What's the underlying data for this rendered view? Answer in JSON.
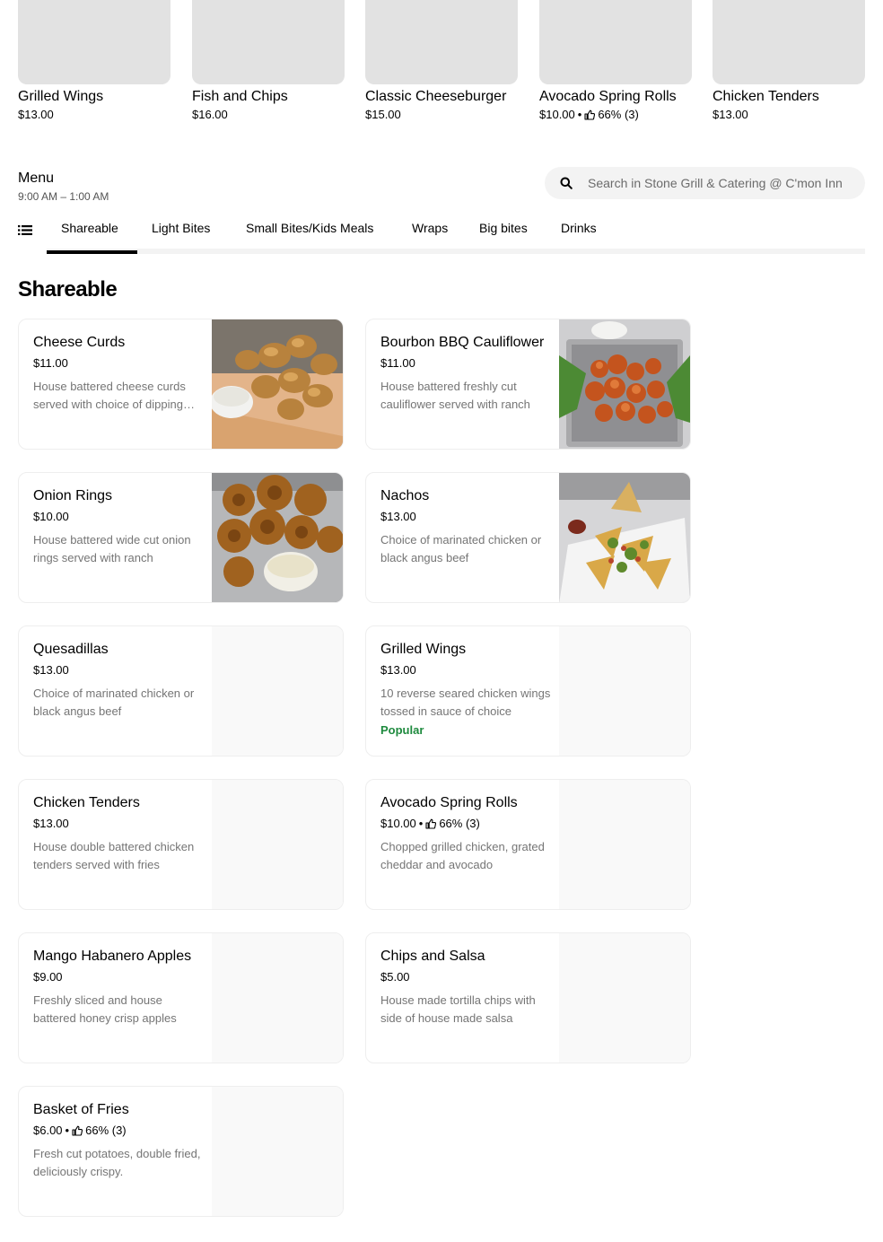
{
  "featured": [
    {
      "name": "Grilled Wings",
      "price": "$13.00",
      "rating": ""
    },
    {
      "name": "Fish and Chips",
      "price": "$16.00",
      "rating": ""
    },
    {
      "name": "Classic Cheeseburger",
      "price": "$15.00",
      "rating": ""
    },
    {
      "name": "Avocado Spring Rolls",
      "price": "$10.00",
      "rating": "66% (3)"
    },
    {
      "name": "Chicken Tenders",
      "price": "$13.00",
      "rating": ""
    }
  ],
  "menu": {
    "title": "Menu",
    "hours": "9:00 AM – 1:00 AM",
    "search_placeholder": "Search in Stone Grill & Catering @ C'mon Inn"
  },
  "tabs": [
    "Shareable",
    "Light Bites",
    "Small Bites/Kids Meals",
    "Wraps",
    "Big bites",
    "Drinks"
  ],
  "section": {
    "title": "Shareable"
  },
  "items": [
    {
      "name": "Cheese Curds",
      "price": "$11.00",
      "rating": "",
      "desc": "House battered cheese curds served with choice of dipping sauce",
      "badge": "",
      "image": "cheese-curds-photo"
    },
    {
      "name": "Bourbon BBQ Cauliflower",
      "price": "$11.00",
      "rating": "",
      "desc": "House battered freshly cut cauliflower served with ranch",
      "badge": "",
      "image": "cauliflower-photo"
    },
    {
      "name": "Onion Rings",
      "price": "$10.00",
      "rating": "",
      "desc": "House battered wide cut onion rings served with ranch",
      "badge": "",
      "image": "onion-rings-photo"
    },
    {
      "name": "Nachos",
      "price": "$13.00",
      "rating": "",
      "desc": "Choice of marinated chicken or black angus beef",
      "badge": "",
      "image": "nachos-photo"
    },
    {
      "name": "Quesadillas",
      "price": "$13.00",
      "rating": "",
      "desc": "Choice of marinated chicken or black angus beef",
      "badge": "",
      "image": ""
    },
    {
      "name": "Grilled Wings",
      "price": "$13.00",
      "rating": "",
      "desc": "10 reverse seared chicken wings tossed in sauce of choice",
      "badge": "Popular",
      "image": ""
    },
    {
      "name": "Chicken Tenders",
      "price": "$13.00",
      "rating": "",
      "desc": "House double battered chicken tenders served with fries",
      "badge": "",
      "image": ""
    },
    {
      "name": "Avocado Spring Rolls",
      "price": "$10.00",
      "rating": "66% (3)",
      "desc": "Chopped grilled chicken, grated cheddar and avocado",
      "badge": "",
      "image": ""
    },
    {
      "name": "Mango Habanero Apples",
      "price": "$9.00",
      "rating": "",
      "desc": "Freshly sliced and house battered honey crisp apples",
      "badge": "",
      "image": ""
    },
    {
      "name": "Chips and Salsa",
      "price": "$5.00",
      "rating": "",
      "desc": "House made tortilla chips with side of house made salsa",
      "badge": "",
      "image": ""
    },
    {
      "name": "Basket of Fries",
      "price": "$6.00",
      "rating": "66% (3)",
      "desc": "Fresh cut potatoes, double fried, deliciously crispy.",
      "badge": "",
      "image": ""
    }
  ],
  "colors": {
    "popular": "#1e8a3e",
    "muted_text": "#757575",
    "placeholder_bg": "#f9f9f9",
    "featured_bg": "#e2e2e2"
  },
  "icons": {
    "search": "search-icon",
    "list": "list-icon",
    "thumb": "thumbs-up-icon"
  }
}
